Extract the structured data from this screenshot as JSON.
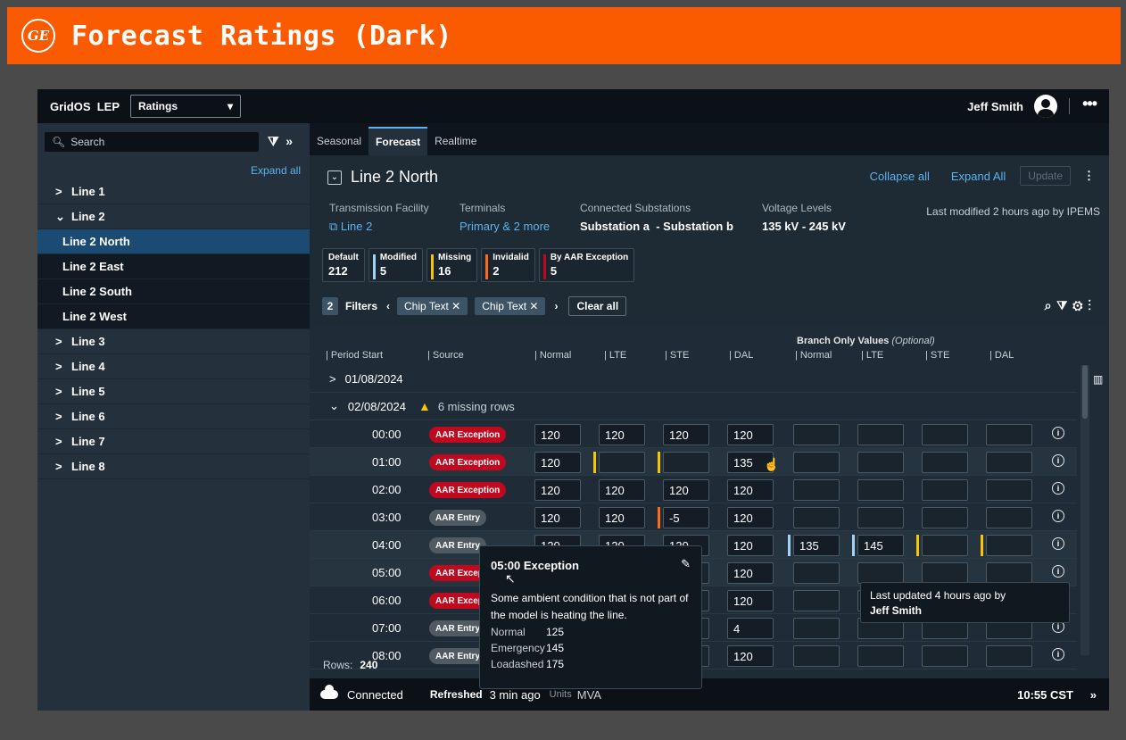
{
  "banner": {
    "logo_text": "GE",
    "title": "Forecast Ratings (Dark)"
  },
  "topbar": {
    "brand": "GridOS  LEP",
    "app_select": "Ratings",
    "user": "Jeff Smith"
  },
  "sidebar": {
    "search_placeholder": "Search",
    "expand_all": "Expand all",
    "items": [
      {
        "label": "Line 1",
        "chev": ">",
        "type": "parent"
      },
      {
        "label": "Line 2",
        "chev": "⌄",
        "type": "parent"
      },
      {
        "label": "Line 2 North",
        "type": "child",
        "active": true
      },
      {
        "label": "Line 2 East",
        "type": "child"
      },
      {
        "label": "Line 2 South",
        "type": "child"
      },
      {
        "label": "Line 2 West",
        "type": "child"
      },
      {
        "label": "Line 3",
        "chev": ">",
        "type": "parent"
      },
      {
        "label": "Line 4",
        "chev": ">",
        "type": "parent"
      },
      {
        "label": "Line 5",
        "chev": ">",
        "type": "parent"
      },
      {
        "label": "Line 6",
        "chev": ">",
        "type": "parent"
      },
      {
        "label": "Line 7",
        "chev": ">",
        "type": "parent"
      },
      {
        "label": "Line 8",
        "chev": ">",
        "type": "parent"
      }
    ]
  },
  "tabs": [
    "Seasonal",
    "Forecast",
    "Realtime"
  ],
  "header": {
    "title": "Line 2 North",
    "collapse_all": "Collapse all",
    "expand_all": "Expand All",
    "update": "Update"
  },
  "meta": {
    "facility_label": "Transmission Facility",
    "facility_value": "Line 2",
    "terminals_label": "Terminals",
    "terminals_value": "Primary & 2 more",
    "substations_label": "Connected Substations",
    "substations_value": "Substation a  - Substation b",
    "voltage_label": "Voltage Levels",
    "voltage_value": "135 kV - 245 kV",
    "last_modified": "Last modified 2 hours ago by IPEMS"
  },
  "summary": [
    {
      "label": "Default",
      "count": "212",
      "color": ""
    },
    {
      "label": "Modified",
      "count": "5",
      "color": "#9fd4f5"
    },
    {
      "label": "Missing",
      "count": "16",
      "color": "#f7c600"
    },
    {
      "label": "Invidalid",
      "count": "2",
      "color": "#ff6a1a"
    },
    {
      "label": "By AAR Exception",
      "count": "5",
      "color": "#c0091f"
    }
  ],
  "filters": {
    "count": "2",
    "label": "Filters",
    "chip1": "Chip Text",
    "chip2": "Chip Text",
    "clear": "Clear all"
  },
  "grid": {
    "branch_title": "Branch Only Values",
    "branch_optional": "(Optional)",
    "columns": [
      "| Period Start",
      "| Source",
      "| Normal",
      "| LTE",
      "| STE",
      "| DAL",
      "| Normal",
      "| LTE",
      "| STE",
      "| DAL"
    ],
    "date1": "01/08/2024",
    "date2": "02/08/2024",
    "missing_rows": "6 missing rows",
    "rows": [
      {
        "time": "00:00",
        "source": "AAR Exception",
        "kind": "exc",
        "vals": [
          "120",
          "120",
          "120",
          "120"
        ]
      },
      {
        "time": "01:00",
        "source": "AAR Exception",
        "kind": "exc",
        "vals": [
          "120",
          "",
          "",
          "135"
        ]
      },
      {
        "time": "02:00",
        "source": "AAR Exception",
        "kind": "exc",
        "vals": [
          "120",
          "120",
          "120",
          "120"
        ]
      },
      {
        "time": "03:00",
        "source": "AAR Entry",
        "kind": "entry",
        "vals": [
          "120",
          "120",
          "-5",
          "120"
        ]
      },
      {
        "time": "04:00",
        "source": "AAR Entry",
        "kind": "entry",
        "vals": [
          "120",
          "120",
          "120",
          "120"
        ],
        "branch": [
          "135",
          "145",
          "",
          ""
        ]
      },
      {
        "time": "05:00",
        "source": "AAR Exception",
        "kind": "exc",
        "vals": [
          "",
          "",
          "",
          "120"
        ]
      },
      {
        "time": "06:00",
        "source": "AAR Exception",
        "kind": "exc",
        "vals": [
          "",
          "",
          "",
          "120"
        ]
      },
      {
        "time": "07:00",
        "source": "AAR Entry",
        "kind": "entry",
        "vals": [
          "",
          "",
          "",
          "4"
        ]
      },
      {
        "time": "08:00",
        "source": "AAR Entry",
        "kind": "entry",
        "vals": [
          "",
          "",
          "",
          "120"
        ]
      }
    ]
  },
  "popover": {
    "title": "05:00 Exception",
    "description": "Some ambient condition that is not part of the model is heating the line.",
    "normal_label": "Normal",
    "normal_value": "125",
    "emergency_label": "Emergency",
    "emergency_value": "145",
    "loadshed_label": "Loadashed",
    "loadshed_value": "175"
  },
  "tooltip": {
    "line1": "Last updated 4 hours ago by",
    "line2": "Jeff Smith"
  },
  "footer": {
    "rows_label": "Rows:",
    "rows_value": "240",
    "connected": "Connected",
    "refreshed_label": "Refreshed",
    "refreshed_value": "3 min ago",
    "units_label": "Units",
    "units_value": "MVA",
    "time": "10:55 CST"
  }
}
